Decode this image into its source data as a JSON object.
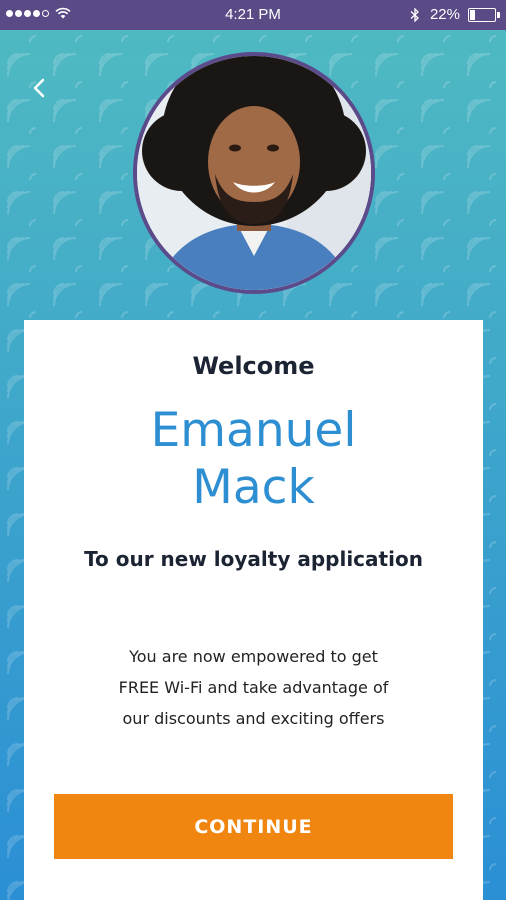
{
  "status_bar": {
    "time": "4:21 PM",
    "battery": "22%",
    "battery_level": 0.22,
    "signal_icon": "signal-dots-icon",
    "wifi_icon": "wifi-icon",
    "bluetooth_icon": "bluetooth-icon"
  },
  "header": {
    "back_icon": "chevron-left-icon"
  },
  "profile": {
    "avatar": "user-avatar"
  },
  "card": {
    "welcome": "Welcome",
    "name_line1": "Emanuel",
    "name_line2": "Mack",
    "subtitle": "To our new loyalty application",
    "body_line1": "You are now empowered to get",
    "body_line2": "FREE Wi-Fi and take advantage of",
    "body_line3": "our discounts and exciting offers",
    "continue_label": "CONTINUE"
  },
  "colors": {
    "status_bar": "#5a4a86",
    "background_top": "#4fb9c2",
    "background_bottom": "#2b8fd4",
    "name_text": "#2d8fd2",
    "button": "#f0850f",
    "avatar_border": "#5b4b8a"
  }
}
